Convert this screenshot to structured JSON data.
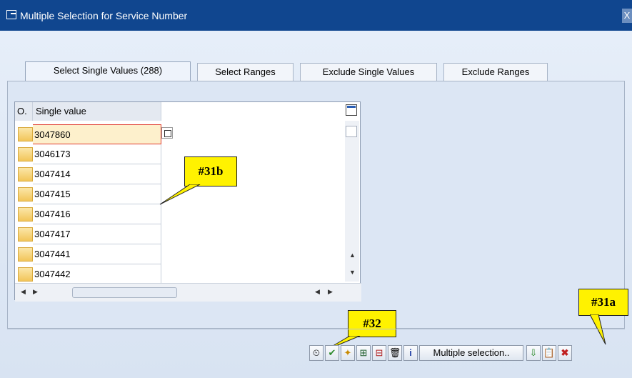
{
  "window": {
    "title": "Multiple Selection for Service Number",
    "close_label": "X"
  },
  "tabs": [
    {
      "label": "Select Single Values (288)",
      "active": true
    },
    {
      "label": "Select Ranges",
      "active": false
    },
    {
      "label": "Exclude Single Values",
      "active": false
    },
    {
      "label": "Exclude Ranges",
      "active": false
    }
  ],
  "grid": {
    "col_option": "O.",
    "col_value": "Single value",
    "rows": [
      "3047860",
      "3046173",
      "3047414",
      "3047415",
      "3047416",
      "3047417",
      "3047441",
      "3047442"
    ]
  },
  "callouts": {
    "c31b": "#31b",
    "c32": "#32",
    "c31a": "#31a"
  },
  "toolbar": {
    "multiple_selection": "Multiple selection..",
    "icons": [
      "clock-execute-icon",
      "check-icon",
      "multi-select-icon",
      "insert-line-icon",
      "delete-line-icon",
      "trash-icon",
      "info-icon",
      "import-icon",
      "paste-clipboard-icon",
      "cancel-icon"
    ]
  },
  "colors": {
    "titlebar": "#10468f",
    "callout": "#fff200",
    "accent": "#2b5fb5"
  }
}
